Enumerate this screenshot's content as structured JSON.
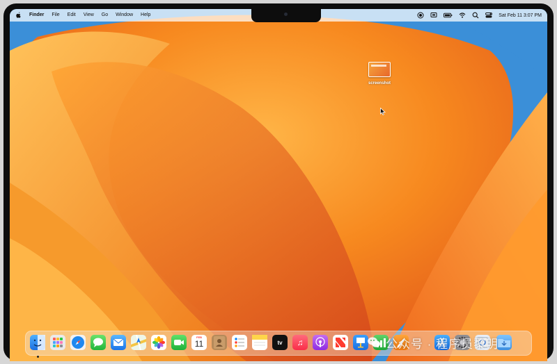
{
  "menubar": {
    "app_name": "Finder",
    "items": [
      "File",
      "Edit",
      "View",
      "Go",
      "Window",
      "Help"
    ],
    "clock": "Sat Feb 11  3:07 PM"
  },
  "desktop": {
    "file_label": "screenshot"
  },
  "dock": {
    "calendar_month": "FEB",
    "calendar_day": "11",
    "apps": [
      "Finder",
      "Launchpad",
      "Safari",
      "Messages",
      "Mail",
      "Maps",
      "Photos",
      "FaceTime",
      "Calendar",
      "Contacts",
      "Reminders",
      "Notes",
      "TV",
      "Music",
      "Podcasts",
      "News",
      "Keynote",
      "Numbers",
      "Pages",
      "App Store",
      "System Settings",
      "Preview",
      "Downloads"
    ]
  },
  "watermark": {
    "text": "公众号 · 程序员黎明"
  },
  "colors": {
    "wallpaper_orange": "#f07a1e",
    "wallpaper_blue": "#3a8fd6",
    "menubar": "#f3e6da"
  }
}
